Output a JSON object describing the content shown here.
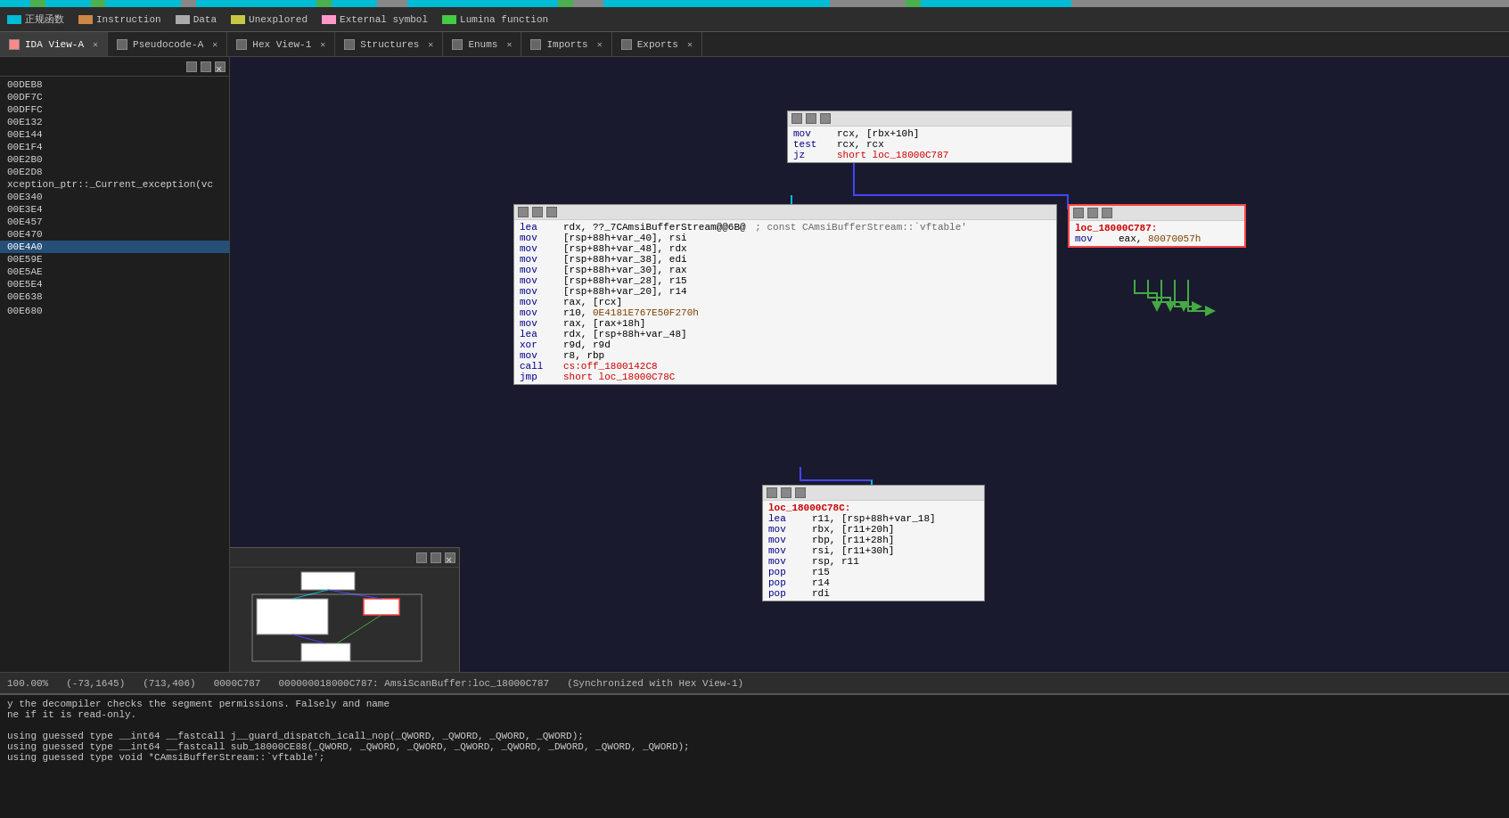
{
  "topbar": {
    "segments": [
      {
        "color": "#00bcd4",
        "width": "2%"
      },
      {
        "color": "#4caf50",
        "width": "1%"
      },
      {
        "color": "#00bcd4",
        "width": "3%"
      },
      {
        "color": "#4caf50",
        "width": "1%"
      },
      {
        "color": "#00bcd4",
        "width": "5%"
      },
      {
        "color": "#888",
        "width": "1%"
      },
      {
        "color": "#00bcd4",
        "width": "8%"
      },
      {
        "color": "#4caf50",
        "width": "1%"
      },
      {
        "color": "#00bcd4",
        "width": "3%"
      },
      {
        "color": "#888",
        "width": "2%"
      },
      {
        "color": "#00bcd4",
        "width": "10%"
      },
      {
        "color": "#4caf50",
        "width": "1%"
      },
      {
        "color": "#888888",
        "width": "2%"
      },
      {
        "color": "#00bcd4",
        "width": "15%"
      },
      {
        "color": "#888",
        "width": "5%"
      },
      {
        "color": "#4caf50",
        "width": "1%"
      },
      {
        "color": "#00bcd4",
        "width": "10%"
      },
      {
        "color": "#888",
        "width": "29%"
      }
    ]
  },
  "legend": {
    "items": [
      {
        "label": "正规函数",
        "color": "#00bcd4"
      },
      {
        "label": "Instruction",
        "color": "#cc8844"
      },
      {
        "label": "Data",
        "color": "#aaaaaa"
      },
      {
        "label": "Unexplored",
        "color": "#c8c844"
      },
      {
        "label": "External symbol",
        "color": "#ff99cc"
      },
      {
        "label": "Lumina function",
        "color": "#44cc44"
      }
    ]
  },
  "tabs": [
    {
      "label": "IDA View-A",
      "active": true,
      "closable": true
    },
    {
      "label": "Pseudocode-A",
      "active": false,
      "closable": true
    },
    {
      "label": "Hex View-1",
      "active": false,
      "closable": true
    },
    {
      "label": "Structures",
      "active": false,
      "closable": true
    },
    {
      "label": "Enums",
      "active": false,
      "closable": true
    },
    {
      "label": "Imports",
      "active": false,
      "closable": true
    },
    {
      "label": "Exports",
      "active": false,
      "closable": true
    }
  ],
  "sidebar": {
    "items": [
      "00DEB8",
      "00DF7C",
      "00DFFC",
      "00E132",
      "00E144",
      "00E1F4",
      "00E2B0",
      "00E2D8",
      "xception_ptr::_Current_exception(vc",
      "00E340",
      "00E3E4",
      "00E457",
      "00E470",
      "00E4A0",
      "00E59E",
      "00E5AE",
      "00E5E4",
      "00E638",
      "",
      "00E680",
      ""
    ],
    "highlighted_index": 13
  },
  "block1": {
    "lines": [
      {
        "mnem": "lea",
        "ops": "rdx, ??_7CAmsiBufferStream@@6B@ ; const CAmsiBufferStream::`vftable'"
      },
      {
        "mnem": "mov",
        "ops": "[rsp+88h+var_40], rsi"
      },
      {
        "mnem": "mov",
        "ops": "[rsp+88h+var_48], rdx"
      },
      {
        "mnem": "mov",
        "ops": "[rsp+88h+var_38], edi"
      },
      {
        "mnem": "mov",
        "ops": "[rsp+88h+var_30], rax"
      },
      {
        "mnem": "mov",
        "ops": "[rsp+88h+var_28], r15"
      },
      {
        "mnem": "mov",
        "ops": "[rsp+88h+var_20], r14"
      },
      {
        "mnem": "mov",
        "ops": "rax, [rcx]"
      },
      {
        "mnem": "mov",
        "ops": "r10, 0E4181E767E50F270h"
      },
      {
        "mnem": "mov",
        "ops": "rax, [rax+18h]"
      },
      {
        "mnem": "lea",
        "ops": "rdx, [rsp+88h+var_48]"
      },
      {
        "mnem": "xor",
        "ops": "r9d, r9d"
      },
      {
        "mnem": "mov",
        "ops": "r8, rbp"
      },
      {
        "mnem": "call",
        "ops": "cs:off_1800142C8"
      },
      {
        "mnem": "jmp",
        "ops": "short loc_18000C78C"
      }
    ]
  },
  "block2": {
    "lines": [
      {
        "text": "mov     rcx, [rbx+10h]"
      },
      {
        "text": "test    rcx, rcx"
      },
      {
        "text": "jz      short loc_18000C787"
      }
    ]
  },
  "block3": {
    "loc": "loc_18000C787:",
    "lines": [
      {
        "text": "mov     eax, 80070057h"
      }
    ]
  },
  "block4": {
    "loc": "loc_18000C78C:",
    "lines": [
      {
        "text": "lea     r11, [rsp+88h+var_18]"
      },
      {
        "text": "mov     rbx, [r11+20h]"
      },
      {
        "text": "mov     rbp, [r11+28h]"
      },
      {
        "text": "mov     rsi, [r11+30h]"
      },
      {
        "text": "mov     rsp, r11"
      },
      {
        "text": "pop     r15"
      },
      {
        "text": "pop     r14"
      },
      {
        "text": "pop     rdi"
      }
    ]
  },
  "statusbar": {
    "zoom": "100.00%",
    "coords": "(-73,1645)",
    "pos": "(713,406)",
    "offset": "0000C787",
    "address": "000000018000C787: AmsiScanBuffer:loc_18000C787",
    "sync": "(Synchronized with Hex View-1)"
  },
  "console": {
    "lines": [
      "y the decompiler checks the segment permissions. Falsely and name",
      "ne if it is read-only.",
      "",
      "using guessed type __int64 __fastcall j__guard_dispatch_icall_nop(_QWORD, _QWORD, _QWORD, _QWORD);",
      "using guessed type __int64 __fastcall sub_18000CE88(_QWORD, _QWORD, _QWORD, _QWORD, _QWORD, _DWORD, _QWORD, _QWORD);",
      "using guessed type void *CAmsiBufferStream::`vftable';"
    ]
  }
}
